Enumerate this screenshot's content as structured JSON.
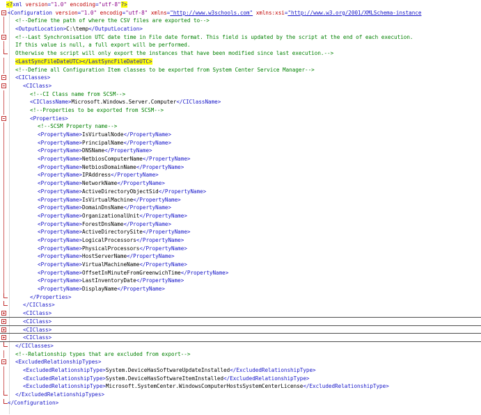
{
  "xml_decl": {
    "open": "<?",
    "name": "xml",
    "attr1": "version",
    "val1": "\"1.0\"",
    "attr2": "encoding",
    "val2": "\"utf-8\"",
    "close": "?>"
  },
  "config_open": {
    "tag": "<Configuration",
    "a1": "version",
    "v1": "\"1.0\"",
    "a2": "encodig",
    "v2": "\"utf-8\"",
    "a3": "xmlns",
    "v3": "\"http://www.w3schools.com\"",
    "a4": "xmlns:xsi",
    "v4": "\"http://www.w3.org/2001/XMLSchema-instance"
  },
  "comment_csv": "<!--Define the path of where the CSV files are exported to-->",
  "output_location": {
    "open": "<OutputLocation>",
    "value": "C:\\temp",
    "close": "</OutputLocation>"
  },
  "comment_sync_1": "<!--Last Synchronisation UTC date time in File date format. This field is updated by the script at the end of each execution.",
  "comment_sync_2": "If this value is null, a full export will be performed.",
  "comment_sync_3": "Otherwise the script will only export the instances that have been modified since last execution.-->",
  "last_sync": "<LastSyncFileDateUTC></LastSyncFileDateUTC>",
  "comment_ci": "<!--Define all Configuration Item classes to be exported from System Center Service Manager-->",
  "ciclasses_open": "<CIClasses>",
  "ciclass_open": "<CIClass>",
  "comment_ciname": "<!--CI Class name from SCSM-->",
  "ciclassname": {
    "open": "<CIClassName>",
    "value": "Microsoft.Windows.Server.Computer",
    "close": "</CIClassName>"
  },
  "comment_props": "<!--Properties to be exported from SCSM-->",
  "properties_open": "<Properties>",
  "comment_scsm_prop": "<!--SCSM Property name-->",
  "propertyname_open": "<PropertyName>",
  "propertyname_close": "</PropertyName>",
  "properties": [
    "IsVirtualNode",
    "PrincipalName",
    "DNSName",
    "NetbiosComputerName",
    "NetbiosDomainName",
    "IPAddress",
    "NetworkName",
    "ActiveDirectoryObjectSid",
    "IsVirtualMachine",
    "DomainDnsName",
    "OrganizationalUnit",
    "ForestDnsName",
    "ActiveDirectorySite",
    "LogicalProcessors",
    "PhysicalProcessors",
    "HostServerName",
    "VirtualMachineName",
    "OffsetInMinuteFromGreenwichTime",
    "LastInventoryDate",
    "DisplayName"
  ],
  "properties_close": "</Properties>",
  "ciclass_close": "</CIClass>",
  "collapsed_ciclasses": [
    "<CIClass>",
    "<CIClass>",
    "<CIClass>",
    "<CIClass>"
  ],
  "ciclasses_close": "</CIClasses>",
  "comment_rel": "<!--Relationship types that are excluded from export-->",
  "excluded_open": "<ExcludedRelationshipTypes>",
  "ert_open": "<ExcludedRelationshipType>",
  "ert_close": "</ExcludedRelationshipType>",
  "excluded_types": [
    "System.DeviceHasSoftwareUpdateInstalled",
    "System.DeviceHasSoftwareItemInstalled",
    "Microsoft.SystemCenter.WindowsComputerHostsSystemCenterLicense"
  ],
  "excluded_close": "</ExcludedRelationshipTypes>",
  "config_close": "</Configuration>",
  "colors": {
    "tag": "#1414c8",
    "attr": "#c00000",
    "value": "#8b0089",
    "comment": "#008000",
    "highlight": "#ffff00",
    "fold": "#c03030"
  }
}
